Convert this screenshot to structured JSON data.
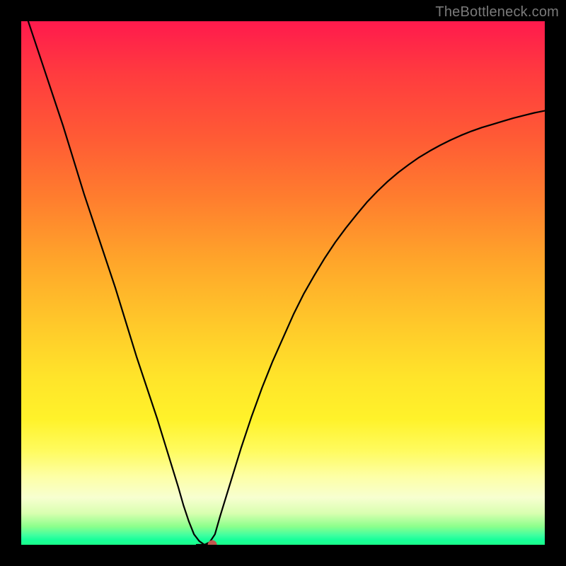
{
  "watermark": "TheBottleneck.com",
  "colors": {
    "frame": "#000000",
    "curve_stroke": "#000000",
    "marker_fill": "#c1584f",
    "watermark": "#7a7a7a"
  },
  "chart_data": {
    "type": "line",
    "title": "",
    "xlabel": "",
    "ylabel": "",
    "xlim": [
      0,
      100
    ],
    "ylim": [
      0,
      100
    ],
    "grid": false,
    "legend": false,
    "x": [
      0,
      2,
      4,
      6,
      8,
      10,
      12,
      14,
      16,
      18,
      20,
      22,
      24,
      26,
      28,
      30,
      31,
      32,
      33,
      34,
      35,
      36,
      37,
      38,
      40,
      42,
      44,
      46,
      48,
      50,
      52,
      54,
      56,
      58,
      60,
      62,
      64,
      66,
      68,
      70,
      72,
      74,
      76,
      78,
      80,
      82,
      84,
      86,
      88,
      90,
      92,
      94,
      96,
      98,
      100
    ],
    "values": [
      104,
      98,
      92,
      86,
      80,
      73.5,
      67,
      61,
      55,
      49,
      42.5,
      36,
      30,
      24,
      17.5,
      11,
      7.5,
      4.5,
      2,
      0.7,
      0,
      0.5,
      2,
      5.5,
      12,
      18.5,
      24.5,
      30,
      35,
      39.5,
      44,
      48,
      51.5,
      54.8,
      57.8,
      60.5,
      63,
      65.4,
      67.5,
      69.4,
      71.1,
      72.6,
      74,
      75.2,
      76.3,
      77.3,
      78.2,
      79,
      79.7,
      80.3,
      80.9,
      81.5,
      82,
      82.5,
      82.9
    ],
    "marker": {
      "x": 36.5,
      "y": 0
    },
    "flat_bottom": {
      "x0": 33.5,
      "x1": 36.5,
      "y": 0
    },
    "background_gradient": "vertical red→orange→yellow→green",
    "note": "x is generic horizontal position (0–100), values are relative heights (0–100) where 0 is the bottom green band and 100 is the top edge. Estimated from pixel positions."
  }
}
